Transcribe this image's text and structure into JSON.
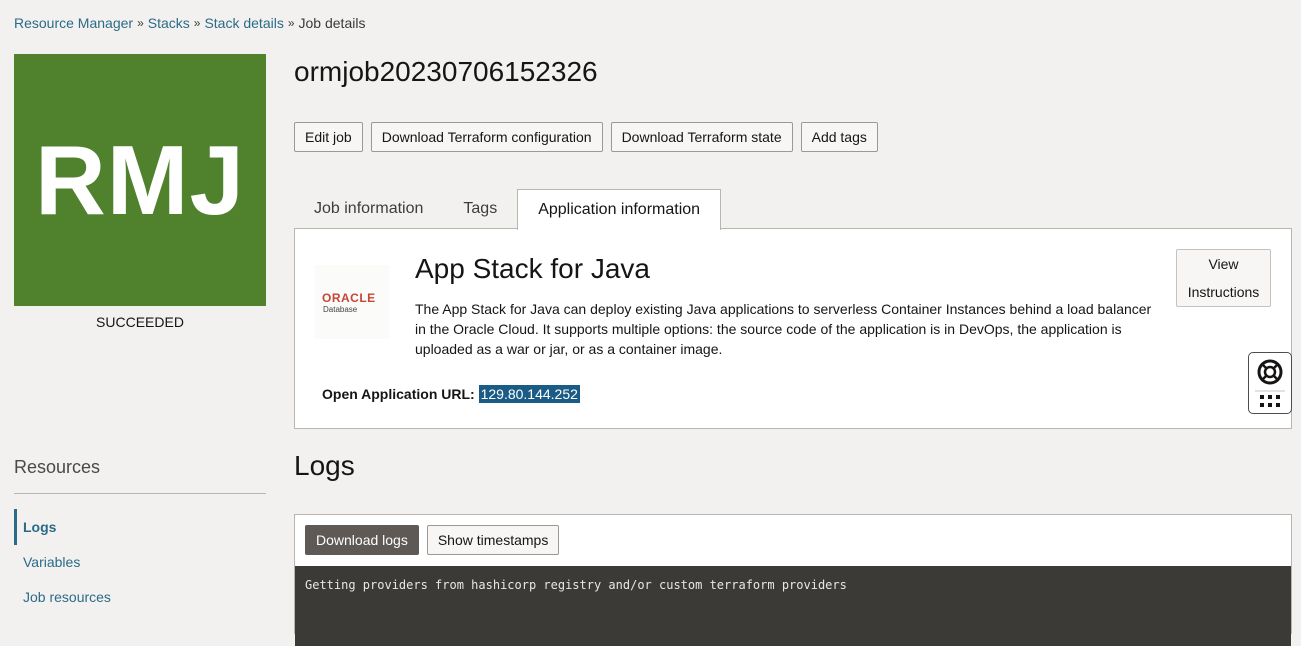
{
  "breadcrumb": {
    "items": [
      "Resource Manager",
      "Stacks",
      "Stack details"
    ],
    "current": "Job details",
    "separator": "»"
  },
  "badge": {
    "text": "RMJ",
    "color": "#50822e"
  },
  "status": "SUCCEEDED",
  "job_title": "ormjob20230706152326",
  "actions": {
    "edit_job": "Edit job",
    "download_config": "Download Terraform configuration",
    "download_state": "Download Terraform state",
    "add_tags": "Add tags"
  },
  "tabs": {
    "job_information": "Job information",
    "tags": "Tags",
    "application_information": "Application information",
    "active": "application_information"
  },
  "app": {
    "logo_brand": "ORACLE",
    "logo_sub": "Database",
    "title": "App Stack for Java",
    "description": "The App Stack for Java can deploy existing Java applications to serverless Container Instances behind a load balancer in the Oracle Cloud. It supports multiple options: the source code of the application is in DevOps, the application is uploaded as a war or jar, or as a container image.",
    "view_button_line1": "View",
    "view_button_line2": "Instructions",
    "url_label": "Open Application URL:",
    "url_value": "129.80.144.252"
  },
  "resources": {
    "title": "Resources",
    "items": [
      "Logs",
      "Variables",
      "Job resources"
    ],
    "active": "Logs"
  },
  "logs": {
    "title": "Logs",
    "download_logs": "Download logs",
    "show_timestamps": "Show timestamps",
    "console_line": "Getting providers from hashicorp registry and/or custom terraform providers"
  }
}
